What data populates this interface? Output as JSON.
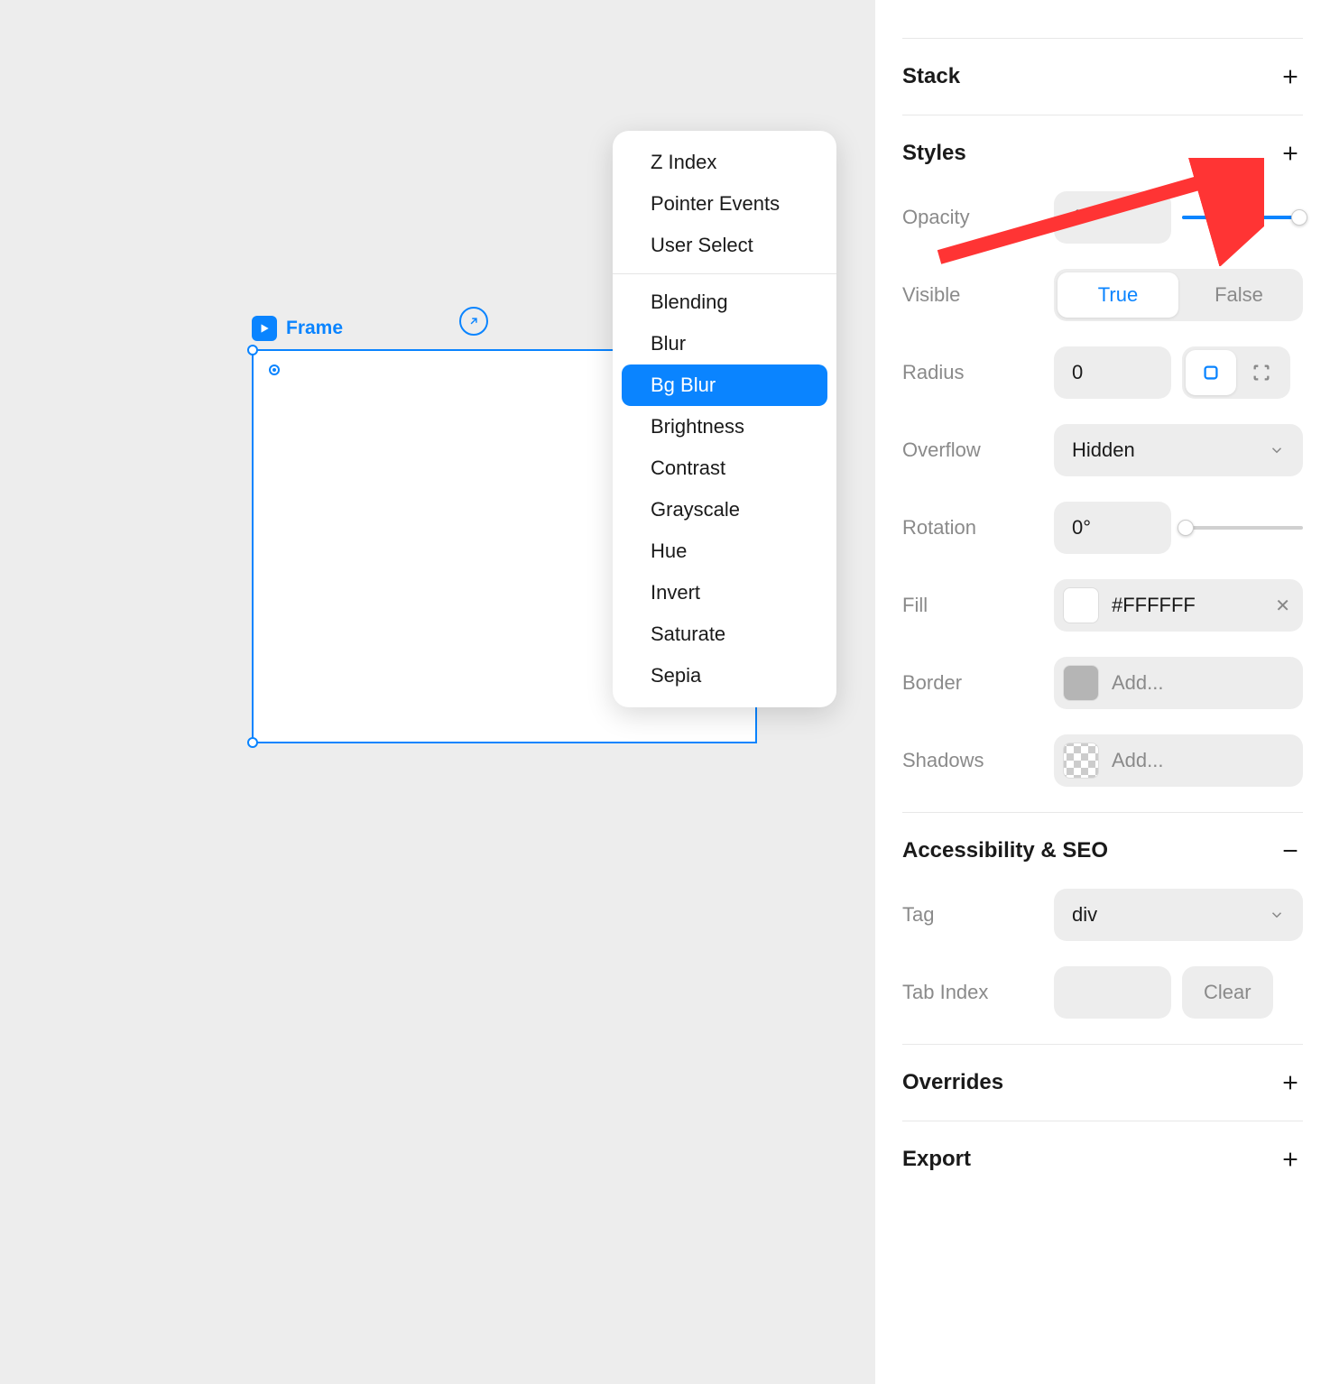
{
  "canvas": {
    "frame_label": "Frame"
  },
  "context_menu": {
    "group1": [
      "Z Index",
      "Pointer Events",
      "User Select"
    ],
    "group2": [
      "Blending",
      "Blur",
      "Bg Blur",
      "Brightness",
      "Contrast",
      "Grayscale",
      "Hue",
      "Invert",
      "Saturate",
      "Sepia"
    ],
    "selected": "Bg Blur"
  },
  "panel": {
    "stack": {
      "title": "Stack"
    },
    "styles": {
      "title": "Styles",
      "opacity": {
        "label": "Opacity",
        "value": "1"
      },
      "visible": {
        "label": "Visible",
        "true": "True",
        "false": "False"
      },
      "radius": {
        "label": "Radius",
        "value": "0"
      },
      "overflow": {
        "label": "Overflow",
        "value": "Hidden"
      },
      "rotation": {
        "label": "Rotation",
        "value": "0°"
      },
      "fill": {
        "label": "Fill",
        "value": "#FFFFFF"
      },
      "border": {
        "label": "Border",
        "placeholder": "Add..."
      },
      "shadows": {
        "label": "Shadows",
        "placeholder": "Add..."
      }
    },
    "a11y": {
      "title": "Accessibility & SEO",
      "tag": {
        "label": "Tag",
        "value": "div"
      },
      "tabindex": {
        "label": "Tab Index",
        "value": "",
        "clear": "Clear"
      }
    },
    "overrides": {
      "title": "Overrides"
    },
    "export": {
      "title": "Export"
    }
  }
}
